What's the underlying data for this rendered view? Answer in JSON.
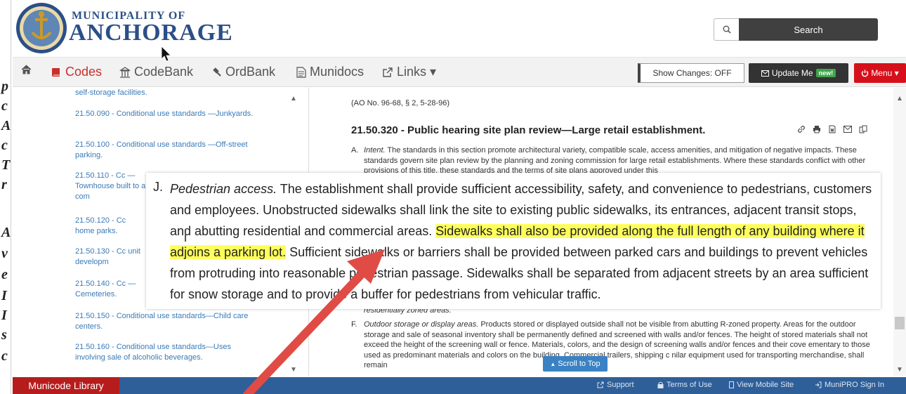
{
  "header": {
    "brand_small": "MUNICIPALITY OF",
    "brand_big": "ANCHORAGE",
    "search_label": "Search"
  },
  "nav": {
    "items": [
      {
        "label": "",
        "icon": "home-icon"
      },
      {
        "label": "Codes",
        "icon": "book-icon"
      },
      {
        "label": "CodeBank",
        "icon": "building-icon"
      },
      {
        "label": "OrdBank",
        "icon": "gavel-icon"
      },
      {
        "label": "Munidocs",
        "icon": "document-icon"
      },
      {
        "label": "Links ▾",
        "icon": "external-link-icon"
      }
    ],
    "show_changes": "Show Changes: OFF",
    "update_me": "Update Me",
    "new_badge": "new!",
    "menu": "Menu ▾"
  },
  "toc": {
    "items": [
      {
        "label": "self-storage facilities."
      },
      {
        "label": "21.50.090 - Conditional use standards —Junkyards."
      },
      {
        "label": "21.50.100 - Conditional use standards —Off-street parking."
      },
      {
        "label": "21.50.110 - Cc —Townhouse built to a com"
      },
      {
        "label": "21.50.120 - Cc home parks."
      },
      {
        "label": "21.50.130 - Cc unit developm"
      },
      {
        "label": "21.50.140 - Cc —Cemeteries."
      },
      {
        "label": "21.50.150 - Conditional use standards—Child care centers."
      },
      {
        "label": "21.50.160 - Conditional use standards—Uses involving sale of alcoholic beverages."
      }
    ]
  },
  "content": {
    "reference": "(AO No. 96-68, § 2, 5-28-96)",
    "section_title": "21.50.320 - Public hearing site plan review—Large retail establishment.",
    "para_a_letter": "A.",
    "para_a_lead": "Intent.",
    "para_a_text": " The standards in this section promote architectural variety, compatible scale, access amenities, and mitigation of negative impacts. These standards govern site plan review by the planning and zoning commission for large retail establishments. Where these standards conflict with other provisions of this title, these standards and the terms of site plans approved under this",
    "para_e_tail": "residentially zoned areas.",
    "para_f_letter": "F.",
    "para_f_lead": "Outdoor storage or display areas.",
    "para_f_text": " Products stored or displayed outside shall not be visible from abutting R-zoned property. Areas for the outdoor storage and sale of seasonal inventory shall be permanently defined and screened with walls and/or fences. The height of stored materials shall not exceed the height of the screening wall or fence. Materials, colors, and the design of screening walls and/or fences and their cove          ementary to those used as predominant materials and colors on the building. Commercial trailers, shipping c          nilar equipment used for transporting merchandise, shall remain"
  },
  "zoom": {
    "letter": "J.",
    "lead": "Pedestrian access.",
    "text_before": " The establishment shall provide sufficient accessibility, safety, and convenience to pedestrians, customers and employees. Unobstructed sidewalks shall link the site to existing public sidewalks, its entrances, adjacent transit stops, and abutting residential and commercial areas. ",
    "highlight": "Sidewalks shall also be provided along the full length of any building where it adjoins a parking lot.",
    "text_after": " Sufficient sidewalks or barriers shall be provided between parked cars and buildings to prevent vehicles from protruding into reasonable pedestrian passage. Sidewalks shall be separated from adjacent streets by an area sufficient for snow storage and to provide a buffer for pedestrians from vehicular traffic."
  },
  "scroll_to_top": "Scroll to Top",
  "footer": {
    "brand": "Municode Library",
    "links": [
      "Support",
      "Terms of Use",
      "View Mobile Site",
      "MuniPRO Sign In"
    ]
  },
  "colors": {
    "brand_blue": "#2b4f87",
    "accent_red": "#c9302c",
    "menu_red": "#d6101a",
    "footer_blue": "#2e5f98",
    "footer_brand_red": "#b71c1c",
    "highlight_yellow": "#ffff5c",
    "annotation_arrow": "#e04b45"
  }
}
